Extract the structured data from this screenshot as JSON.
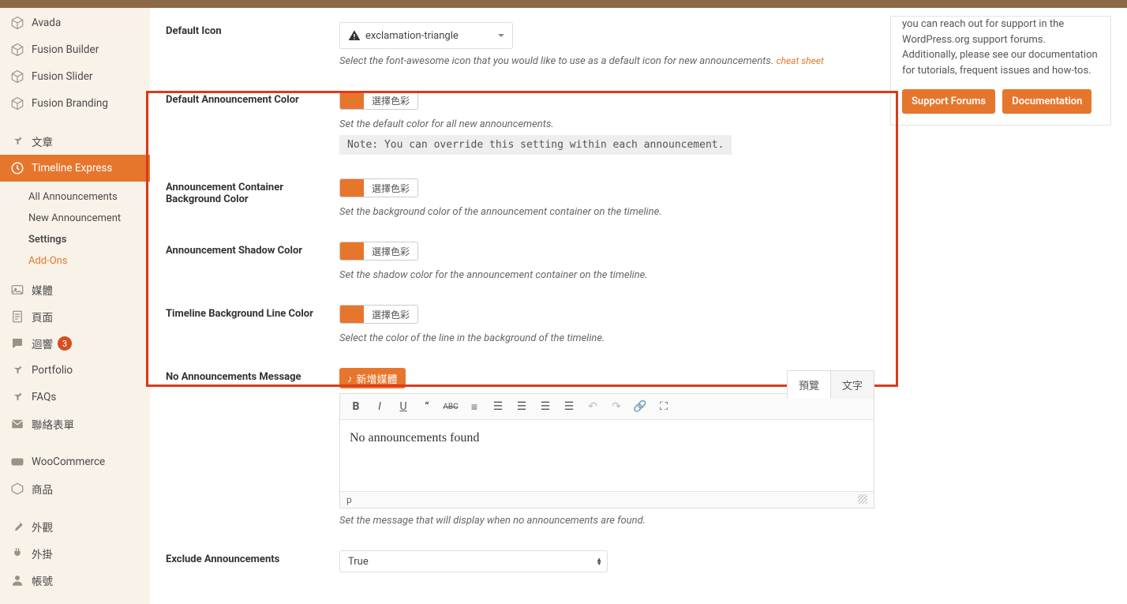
{
  "sidebar": {
    "groups": [
      [
        {
          "icon": "cube",
          "label": "Avada"
        },
        {
          "icon": "cube",
          "label": "Fusion Builder"
        },
        {
          "icon": "cube",
          "label": "Fusion Slider"
        },
        {
          "icon": "cube",
          "label": "Fusion Branding"
        }
      ],
      [
        {
          "icon": "pin",
          "label": "文章"
        },
        {
          "icon": "clock",
          "label": "Timeline Express",
          "active": true
        }
      ]
    ],
    "submenu": [
      {
        "label": "All Announcements"
      },
      {
        "label": "New Announcement"
      },
      {
        "label": "Settings",
        "current": true
      },
      {
        "label": "Add-Ons",
        "addons": true
      }
    ],
    "tail": [
      {
        "icon": "media",
        "label": "媒體"
      },
      {
        "icon": "page",
        "label": "頁面"
      },
      {
        "icon": "comment",
        "label": "迴響",
        "badge": "3"
      },
      {
        "icon": "pin",
        "label": "Portfolio"
      },
      {
        "icon": "pin",
        "label": "FAQs"
      },
      {
        "icon": "mail",
        "label": "聯絡表單"
      }
    ],
    "tail2": [
      {
        "icon": "woo",
        "label": "WooCommerce"
      },
      {
        "icon": "box",
        "label": "商品"
      }
    ],
    "tail3": [
      {
        "icon": "brush",
        "label": "外觀"
      },
      {
        "icon": "plug",
        "label": "外掛"
      },
      {
        "icon": "user",
        "label": "帳號"
      }
    ]
  },
  "settings": {
    "default_icon": {
      "label": "Default Icon",
      "value": "exclamation-triangle",
      "help": "Select the font-awesome icon that you would like to use as a default icon for new announcements.",
      "cheat": "cheat sheet"
    },
    "color_rows": [
      {
        "label": "Default Announcement Color",
        "help": "Set the default color for all new announcements.",
        "note": "Note: You can override this setting within each announcement."
      },
      {
        "label": "Announcement Container Background Color",
        "help": "Set the background color of the announcement container on the timeline."
      },
      {
        "label": "Announcement Shadow Color",
        "help": "Set the shadow color for the announcement container on the timeline."
      },
      {
        "label": "Timeline Background Line Color",
        "help": "Select the color of the line in the background of the timeline."
      }
    ],
    "choose_color": "選擇色彩",
    "no_ann": {
      "label": "No Announcements Message",
      "media_btn": "新增媒體",
      "tabs": {
        "visual": "預覽",
        "text": "文字"
      },
      "content": "No announcements found",
      "path": "p",
      "help": "Set the message that will display when no announcements are found."
    },
    "exclude": {
      "label": "Exclude Announcements",
      "value": "True"
    }
  },
  "right": {
    "text": "you can reach out for support in the WordPress.org support forums. Additionally, please see our documentation for tutorials, frequent issues and how-tos.",
    "btn1": "Support Forums",
    "btn2": "Documentation"
  }
}
